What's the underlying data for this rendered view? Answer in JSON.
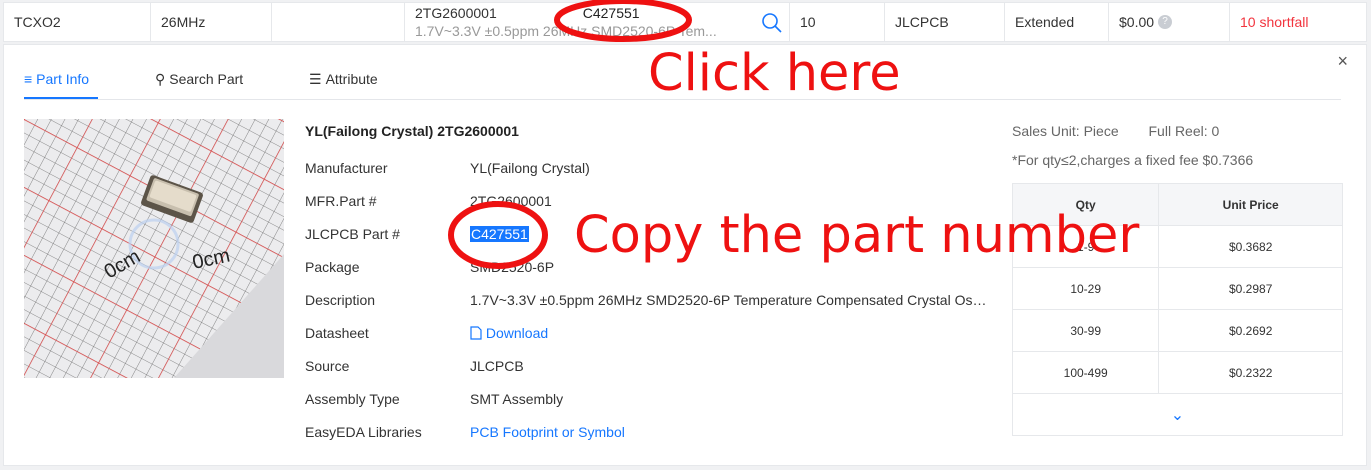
{
  "row": {
    "type": "TCXO2",
    "freq": "26MHz",
    "mfr_part": "2TG2600001",
    "desc": "1.7V~3.3V ±0.5ppm 26MHz SMD2520-6P Tem...",
    "lcsc": "C427551",
    "qty": "10",
    "supplier": "JLCPCB",
    "type_lib": "Extended",
    "price": "$0.00",
    "help": "?",
    "stock_status": "10 shortfall"
  },
  "tabs": [
    {
      "icon": "≡",
      "label": "Part Info"
    },
    {
      "icon": "⚲",
      "label": "Search Part"
    },
    {
      "icon": "☰",
      "label": "Attribute"
    }
  ],
  "close": "×",
  "part": {
    "title": "YL(Failong Crystal) 2TG2600001",
    "fields": [
      {
        "label": "Manufacturer",
        "value": "YL(Failong Crystal)"
      },
      {
        "label": "MFR.Part #",
        "value": "2TG2600001"
      },
      {
        "label": "JLCPCB Part #",
        "value": "C427551"
      },
      {
        "label": "Package",
        "value": "SMD2520-6P"
      },
      {
        "label": "Description",
        "value": "1.7V~3.3V ±0.5ppm 26MHz SMD2520-6P Temperature Compensated Crystal Os…"
      },
      {
        "label": "Datasheet",
        "value": "Download"
      },
      {
        "label": "Source",
        "value": "JLCPCB"
      },
      {
        "label": "Assembly Type",
        "value": "SMT Assembly"
      },
      {
        "label": "EasyEDA Libraries",
        "value": "PCB Footprint or Symbol"
      }
    ]
  },
  "photo_text": {
    "a": "0cm",
    "b": "0cm"
  },
  "sales": {
    "unit": "Sales Unit:  Piece",
    "reel": "Full Reel:  0",
    "note": "*For qty≤2,charges a fixed fee $0.7366"
  },
  "pricing": {
    "headers": [
      "Qty",
      "Unit Price"
    ],
    "rows": [
      [
        "1-9",
        "$0.3682"
      ],
      [
        "10-29",
        "$0.2987"
      ],
      [
        "30-99",
        "$0.2692"
      ],
      [
        "100-499",
        "$0.2322"
      ]
    ],
    "more": "⌄"
  },
  "annotations": {
    "click_here": "Click here",
    "copy": "Copy the part number"
  },
  "colors": {
    "accent": "#1677ff",
    "annotation": "#ee1111",
    "shortfall": "#f2343e"
  }
}
